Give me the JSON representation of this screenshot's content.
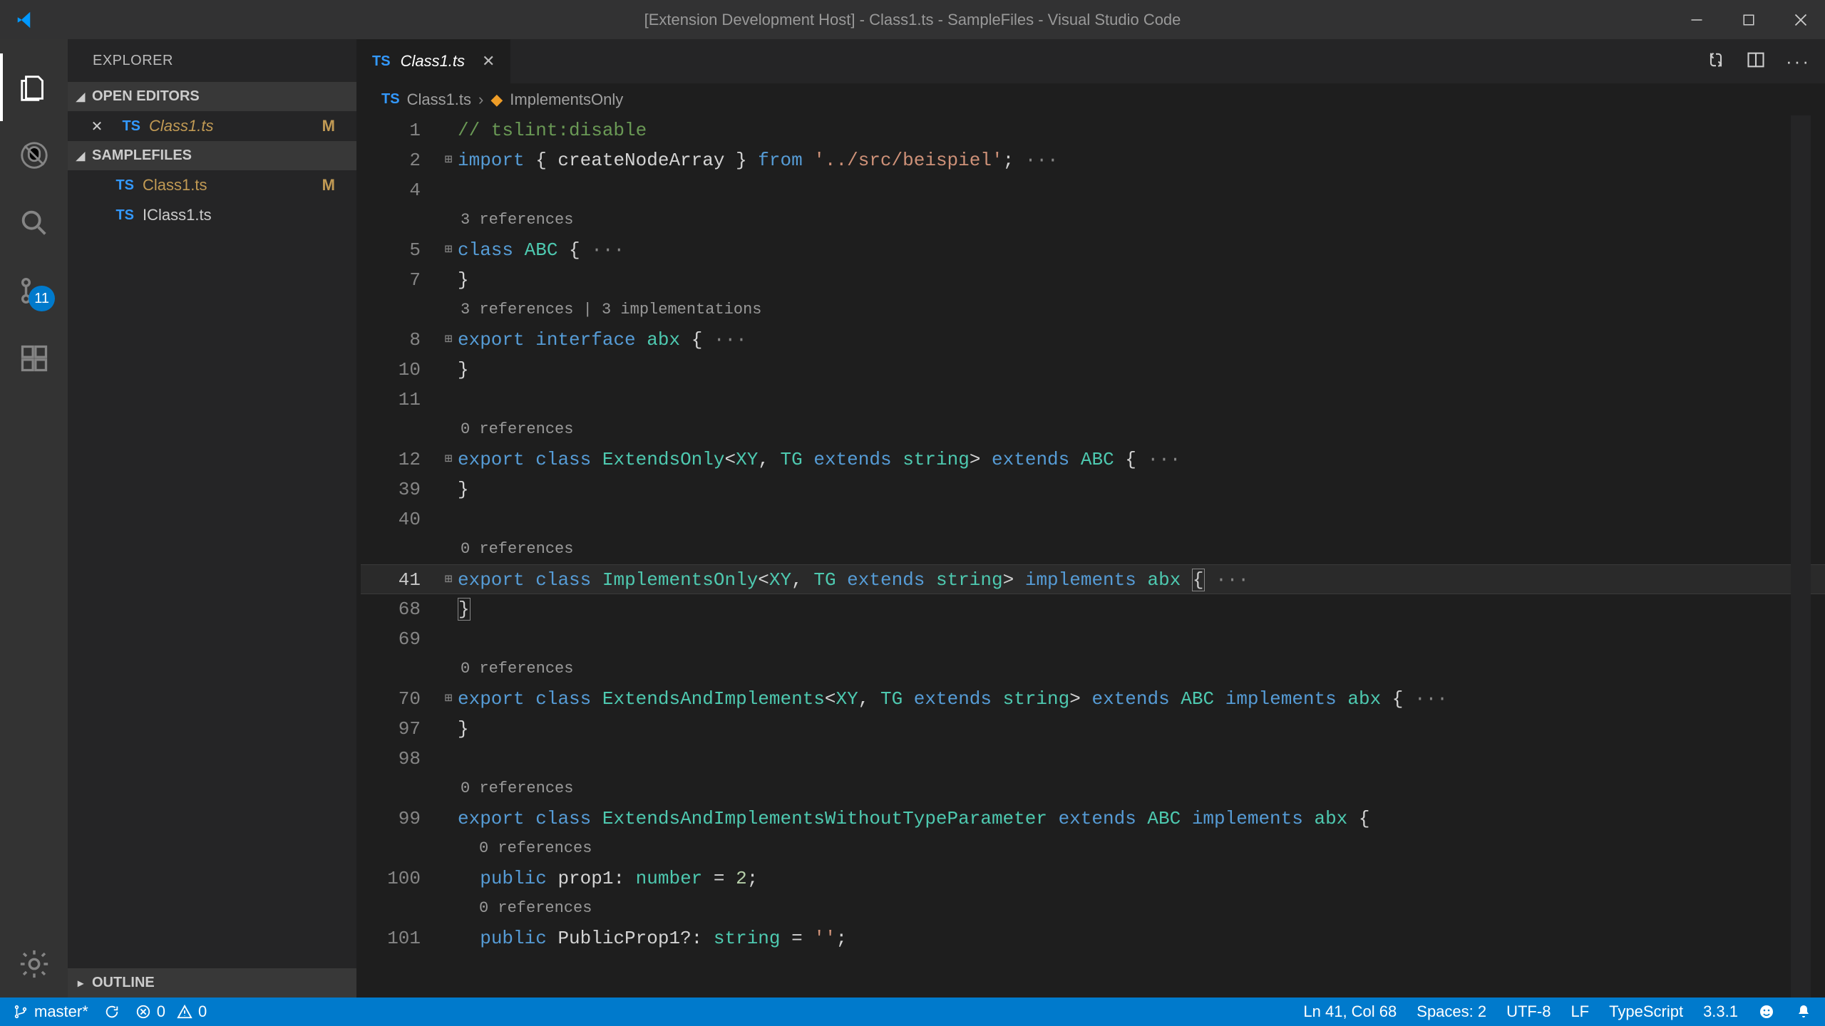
{
  "titlebar": {
    "title": "[Extension Development Host] - Class1.ts - SampleFiles - Visual Studio Code"
  },
  "activitybar": {
    "scm_badge": "11"
  },
  "sidebar": {
    "title": "EXPLORER",
    "sections": {
      "open_editors": {
        "label": "OPEN EDITORS",
        "items": [
          {
            "name": "Class1.ts",
            "modified": "M",
            "italic": true,
            "closeable": true
          }
        ]
      },
      "folder": {
        "label": "SAMPLEFILES",
        "items": [
          {
            "name": "Class1.ts",
            "modified": "M"
          },
          {
            "name": "IClass1.ts",
            "modified": ""
          }
        ]
      },
      "outline": {
        "label": "OUTLINE"
      }
    }
  },
  "tabs": {
    "active": {
      "name": "Class1.ts"
    }
  },
  "breadcrumb": {
    "file": "Class1.ts",
    "symbol": "ImplementsOnly"
  },
  "code": {
    "lines": [
      {
        "ln": "1",
        "fold": "",
        "tokens": [
          {
            "t": "comment",
            "v": "// tslint:disable"
          }
        ]
      },
      {
        "ln": "2",
        "fold": "⊞",
        "tokens": [
          {
            "t": "keyword",
            "v": "import"
          },
          {
            "t": "ident",
            "v": " { createNodeArray } "
          },
          {
            "t": "keyword",
            "v": "from"
          },
          {
            "t": "ident",
            "v": " "
          },
          {
            "t": "string",
            "v": "'../src/beispiel'"
          },
          {
            "t": "ident",
            "v": ";"
          },
          {
            "t": "dots",
            "v": " ···"
          }
        ]
      },
      {
        "ln": "4",
        "fold": "",
        "tokens": []
      },
      {
        "codelens": "3 references"
      },
      {
        "ln": "5",
        "fold": "⊞",
        "tokens": [
          {
            "t": "keyword",
            "v": "class"
          },
          {
            "t": "ident",
            "v": " "
          },
          {
            "t": "type",
            "v": "ABC"
          },
          {
            "t": "ident",
            "v": " {"
          },
          {
            "t": "dots",
            "v": " ···"
          }
        ]
      },
      {
        "ln": "7",
        "fold": "",
        "tokens": [
          {
            "t": "ident",
            "v": "}"
          }
        ]
      },
      {
        "codelens": "3 references | 3 implementations"
      },
      {
        "ln": "8",
        "fold": "⊞",
        "tokens": [
          {
            "t": "keyword",
            "v": "export"
          },
          {
            "t": "ident",
            "v": " "
          },
          {
            "t": "keyword",
            "v": "interface"
          },
          {
            "t": "ident",
            "v": " "
          },
          {
            "t": "type",
            "v": "abx"
          },
          {
            "t": "ident",
            "v": " {"
          },
          {
            "t": "dots",
            "v": " ···"
          }
        ]
      },
      {
        "ln": "10",
        "fold": "",
        "tokens": [
          {
            "t": "ident",
            "v": "}"
          }
        ]
      },
      {
        "ln": "11",
        "fold": "",
        "tokens": []
      },
      {
        "codelens": "0 references"
      },
      {
        "ln": "12",
        "fold": "⊞",
        "tokens": [
          {
            "t": "keyword",
            "v": "export"
          },
          {
            "t": "ident",
            "v": " "
          },
          {
            "t": "keyword",
            "v": "class"
          },
          {
            "t": "ident",
            "v": " "
          },
          {
            "t": "type",
            "v": "ExtendsOnly"
          },
          {
            "t": "ident",
            "v": "<"
          },
          {
            "t": "type",
            "v": "XY"
          },
          {
            "t": "ident",
            "v": ", "
          },
          {
            "t": "type",
            "v": "TG"
          },
          {
            "t": "ident",
            "v": " "
          },
          {
            "t": "keyword",
            "v": "extends"
          },
          {
            "t": "ident",
            "v": " "
          },
          {
            "t": "type",
            "v": "string"
          },
          {
            "t": "ident",
            "v": "> "
          },
          {
            "t": "keyword",
            "v": "extends"
          },
          {
            "t": "ident",
            "v": " "
          },
          {
            "t": "type",
            "v": "ABC"
          },
          {
            "t": "ident",
            "v": " {"
          },
          {
            "t": "dots",
            "v": " ···"
          }
        ]
      },
      {
        "ln": "39",
        "fold": "",
        "tokens": [
          {
            "t": "ident",
            "v": "}"
          }
        ]
      },
      {
        "ln": "40",
        "fold": "",
        "tokens": []
      },
      {
        "codelens": "0 references"
      },
      {
        "ln": "41",
        "fold": "⊞",
        "highlighted": true,
        "tokens": [
          {
            "t": "keyword",
            "v": "export"
          },
          {
            "t": "ident",
            "v": " "
          },
          {
            "t": "keyword",
            "v": "class"
          },
          {
            "t": "ident",
            "v": " "
          },
          {
            "t": "type",
            "v": "ImplementsOnly"
          },
          {
            "t": "ident",
            "v": "<"
          },
          {
            "t": "type",
            "v": "XY"
          },
          {
            "t": "ident",
            "v": ", "
          },
          {
            "t": "type",
            "v": "TG"
          },
          {
            "t": "ident",
            "v": " "
          },
          {
            "t": "keyword",
            "v": "extends"
          },
          {
            "t": "ident",
            "v": " "
          },
          {
            "t": "type",
            "v": "string"
          },
          {
            "t": "ident",
            "v": "> "
          },
          {
            "t": "keyword",
            "v": "implements"
          },
          {
            "t": "ident",
            "v": " "
          },
          {
            "t": "type",
            "v": "abx"
          },
          {
            "t": "ident",
            "v": " "
          },
          {
            "t": "matched",
            "v": "{"
          },
          {
            "t": "dots",
            "v": " ···"
          }
        ]
      },
      {
        "ln": "68",
        "fold": "",
        "tokens": [
          {
            "t": "matched",
            "v": "}"
          }
        ]
      },
      {
        "ln": "69",
        "fold": "",
        "tokens": []
      },
      {
        "codelens": "0 references"
      },
      {
        "ln": "70",
        "fold": "⊞",
        "tokens": [
          {
            "t": "keyword",
            "v": "export"
          },
          {
            "t": "ident",
            "v": " "
          },
          {
            "t": "keyword",
            "v": "class"
          },
          {
            "t": "ident",
            "v": " "
          },
          {
            "t": "type",
            "v": "ExtendsAndImplements"
          },
          {
            "t": "ident",
            "v": "<"
          },
          {
            "t": "type",
            "v": "XY"
          },
          {
            "t": "ident",
            "v": ", "
          },
          {
            "t": "type",
            "v": "TG"
          },
          {
            "t": "ident",
            "v": " "
          },
          {
            "t": "keyword",
            "v": "extends"
          },
          {
            "t": "ident",
            "v": " "
          },
          {
            "t": "type",
            "v": "string"
          },
          {
            "t": "ident",
            "v": "> "
          },
          {
            "t": "keyword",
            "v": "extends"
          },
          {
            "t": "ident",
            "v": " "
          },
          {
            "t": "type",
            "v": "ABC"
          },
          {
            "t": "ident",
            "v": " "
          },
          {
            "t": "keyword",
            "v": "implements"
          },
          {
            "t": "ident",
            "v": " "
          },
          {
            "t": "type",
            "v": "abx"
          },
          {
            "t": "ident",
            "v": " {"
          },
          {
            "t": "dots",
            "v": " ···"
          }
        ]
      },
      {
        "ln": "97",
        "fold": "",
        "tokens": [
          {
            "t": "ident",
            "v": "}"
          }
        ]
      },
      {
        "ln": "98",
        "fold": "",
        "tokens": []
      },
      {
        "codelens": "0 references"
      },
      {
        "ln": "99",
        "fold": "",
        "tokens": [
          {
            "t": "keyword",
            "v": "export"
          },
          {
            "t": "ident",
            "v": " "
          },
          {
            "t": "keyword",
            "v": "class"
          },
          {
            "t": "ident",
            "v": " "
          },
          {
            "t": "type",
            "v": "ExtendsAndImplementsWithoutTypeParameter"
          },
          {
            "t": "ident",
            "v": " "
          },
          {
            "t": "keyword",
            "v": "extends"
          },
          {
            "t": "ident",
            "v": " "
          },
          {
            "t": "type",
            "v": "ABC"
          },
          {
            "t": "ident",
            "v": " "
          },
          {
            "t": "keyword",
            "v": "implements"
          },
          {
            "t": "ident",
            "v": " "
          },
          {
            "t": "type",
            "v": "abx"
          },
          {
            "t": "ident",
            "v": " {"
          }
        ]
      },
      {
        "codelens_indent": "0 references"
      },
      {
        "ln": "100",
        "fold": "",
        "indent": "  ",
        "tokens": [
          {
            "t": "keyword",
            "v": "public"
          },
          {
            "t": "ident",
            "v": " prop1: "
          },
          {
            "t": "type",
            "v": "number"
          },
          {
            "t": "ident",
            "v": " = "
          },
          {
            "t": "num",
            "v": "2"
          },
          {
            "t": "ident",
            "v": ";"
          }
        ]
      },
      {
        "codelens_indent": "0 references"
      },
      {
        "ln": "101",
        "fold": "",
        "indent": "  ",
        "tokens": [
          {
            "t": "keyword",
            "v": "public"
          },
          {
            "t": "ident",
            "v": " PublicProp1?: "
          },
          {
            "t": "type",
            "v": "string"
          },
          {
            "t": "ident",
            "v": " = "
          },
          {
            "t": "string",
            "v": "''"
          },
          {
            "t": "ident",
            "v": ";"
          }
        ]
      }
    ]
  },
  "statusbar": {
    "branch": "master*",
    "errors": "0",
    "warnings": "0",
    "cursor": "Ln 41, Col 68",
    "spaces": "Spaces: 2",
    "encoding": "UTF-8",
    "eol": "LF",
    "language": "TypeScript",
    "tsversion": "3.3.1"
  }
}
